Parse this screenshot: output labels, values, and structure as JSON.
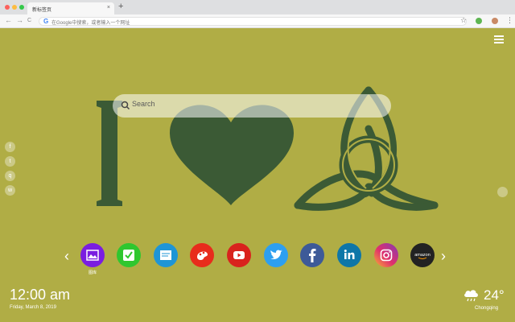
{
  "browser": {
    "tab_title": "新标签页",
    "tab_close": "×",
    "new_tab": "+",
    "back": "←",
    "forward": "→",
    "reload": "C",
    "omnibox_icon": "G",
    "omnibox_placeholder": "在Google中搜索，或者输入一个网址",
    "bookmark_star": "☆",
    "menu_kebab": "⋮"
  },
  "search": {
    "placeholder": "Search"
  },
  "dock": {
    "prev": "‹",
    "next": "›",
    "first_app_label": "图库"
  },
  "clock": {
    "time": "12:00 am",
    "date": "Friday, March 8, 2019"
  },
  "weather": {
    "temperature": "24°",
    "city": "Chongqing",
    "icon": "cloud-rain-icon"
  },
  "colors": {
    "background": "#b0ad45",
    "artwork": "#3b5a35"
  }
}
